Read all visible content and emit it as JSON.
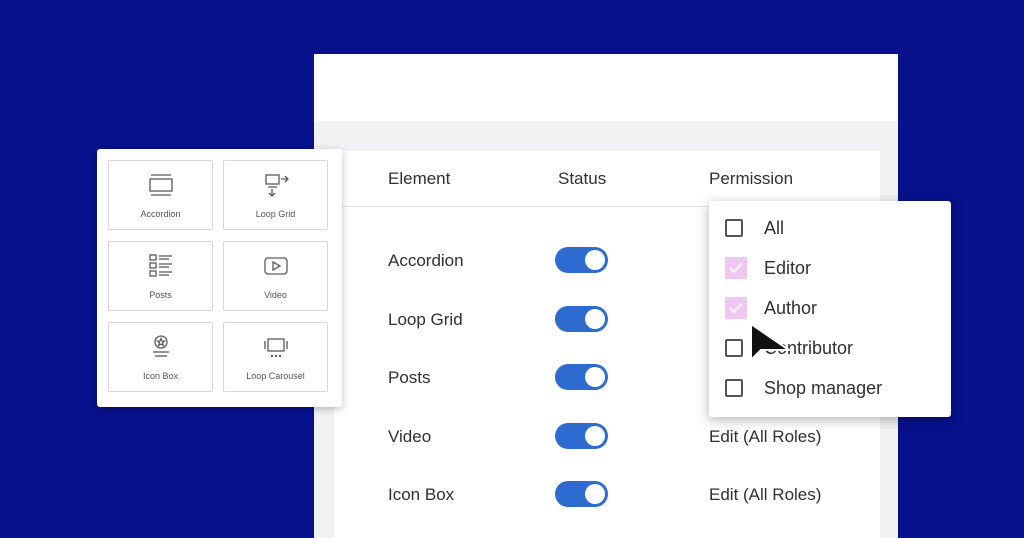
{
  "table": {
    "headers": [
      "Element",
      "Status",
      "Permission"
    ],
    "rows": [
      {
        "element": "Accordion",
        "status": "on",
        "permission": ""
      },
      {
        "element": "Loop Grid",
        "status": "on",
        "permission": ""
      },
      {
        "element": "Posts",
        "status": "on",
        "permission": ""
      },
      {
        "element": "Video",
        "status": "on",
        "permission": "Edit (All Roles)"
      },
      {
        "element": "Icon Box",
        "status": "on",
        "permission": "Edit (All Roles)"
      }
    ]
  },
  "widgets": [
    {
      "label": "Accordion",
      "icon": "accordion-icon"
    },
    {
      "label": "Loop Grid",
      "icon": "loop-grid-icon"
    },
    {
      "label": "Posts",
      "icon": "posts-icon"
    },
    {
      "label": "Video",
      "icon": "video-icon"
    },
    {
      "label": "Icon Box",
      "icon": "icon-box-icon"
    },
    {
      "label": "Loop Carousel",
      "icon": "loop-carousel-icon"
    }
  ],
  "permission_dropdown": {
    "options": [
      {
        "label": "All",
        "checked": false
      },
      {
        "label": "Editor",
        "checked": true
      },
      {
        "label": "Author",
        "checked": true
      },
      {
        "label": "Contributor",
        "checked": false
      },
      {
        "label": "Shop manager",
        "checked": false
      }
    ]
  },
  "colors": {
    "background": "#07128c",
    "toggle_on": "#2e6bd0",
    "checkbox_checked": "#f2c6f2"
  }
}
